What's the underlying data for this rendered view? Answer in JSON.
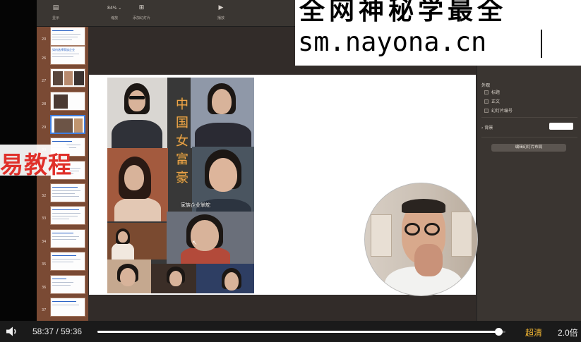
{
  "toolbar": {
    "items": [
      {
        "icon": "view-icon",
        "label": "显示"
      },
      {
        "icon": "zoom-icon",
        "label": "缩放",
        "value": "84%"
      },
      {
        "icon": "add-slide-icon",
        "label": "添加幻灯片"
      },
      {
        "icon": "play-icon",
        "label": "播放"
      }
    ]
  },
  "navigator": {
    "items": [
      {
        "num": "20",
        "title": "",
        "kind": "text"
      },
      {
        "num": "26",
        "title": "如何选择家族企业",
        "kind": "text"
      },
      {
        "num": "27",
        "title": "",
        "kind": "photos"
      },
      {
        "num": "28",
        "title": "",
        "kind": "photo"
      },
      {
        "num": "29",
        "title": "",
        "kind": "photo"
      },
      {
        "num": "30",
        "title": "",
        "kind": "text"
      },
      {
        "num": "31",
        "title": "",
        "kind": "text"
      },
      {
        "num": "32",
        "title": "",
        "kind": "text"
      },
      {
        "num": "33",
        "title": "",
        "kind": "text"
      },
      {
        "num": "34",
        "title": "",
        "kind": "text"
      },
      {
        "num": "35",
        "title": "",
        "kind": "text"
      },
      {
        "num": "36",
        "title": "",
        "kind": "text"
      },
      {
        "num": "37",
        "title": "",
        "kind": "text"
      }
    ]
  },
  "slide": {
    "title_chars": [
      "中",
      "国",
      "女",
      "富",
      "豪"
    ],
    "caption": "家族企业掌舵"
  },
  "inspector": {
    "section_title": "外观",
    "options": [
      {
        "label": "标题",
        "checked": false
      },
      {
        "label": "正文",
        "checked": false
      },
      {
        "label": "幻灯片编号",
        "checked": false
      }
    ],
    "background_label": "背景",
    "background_color": "#ffffff",
    "edit_layout_button": "编辑幻灯片布局"
  },
  "watermark": {
    "line1": "全网神秘学最全",
    "line2": "sm.nayona.cn"
  },
  "side_banner": {
    "text": "易教程"
  },
  "player": {
    "current_time": "58:37",
    "separator": "/",
    "total_time": "59:36",
    "progress": 0.9835,
    "quality": "超清",
    "speed": "2.0倍"
  }
}
